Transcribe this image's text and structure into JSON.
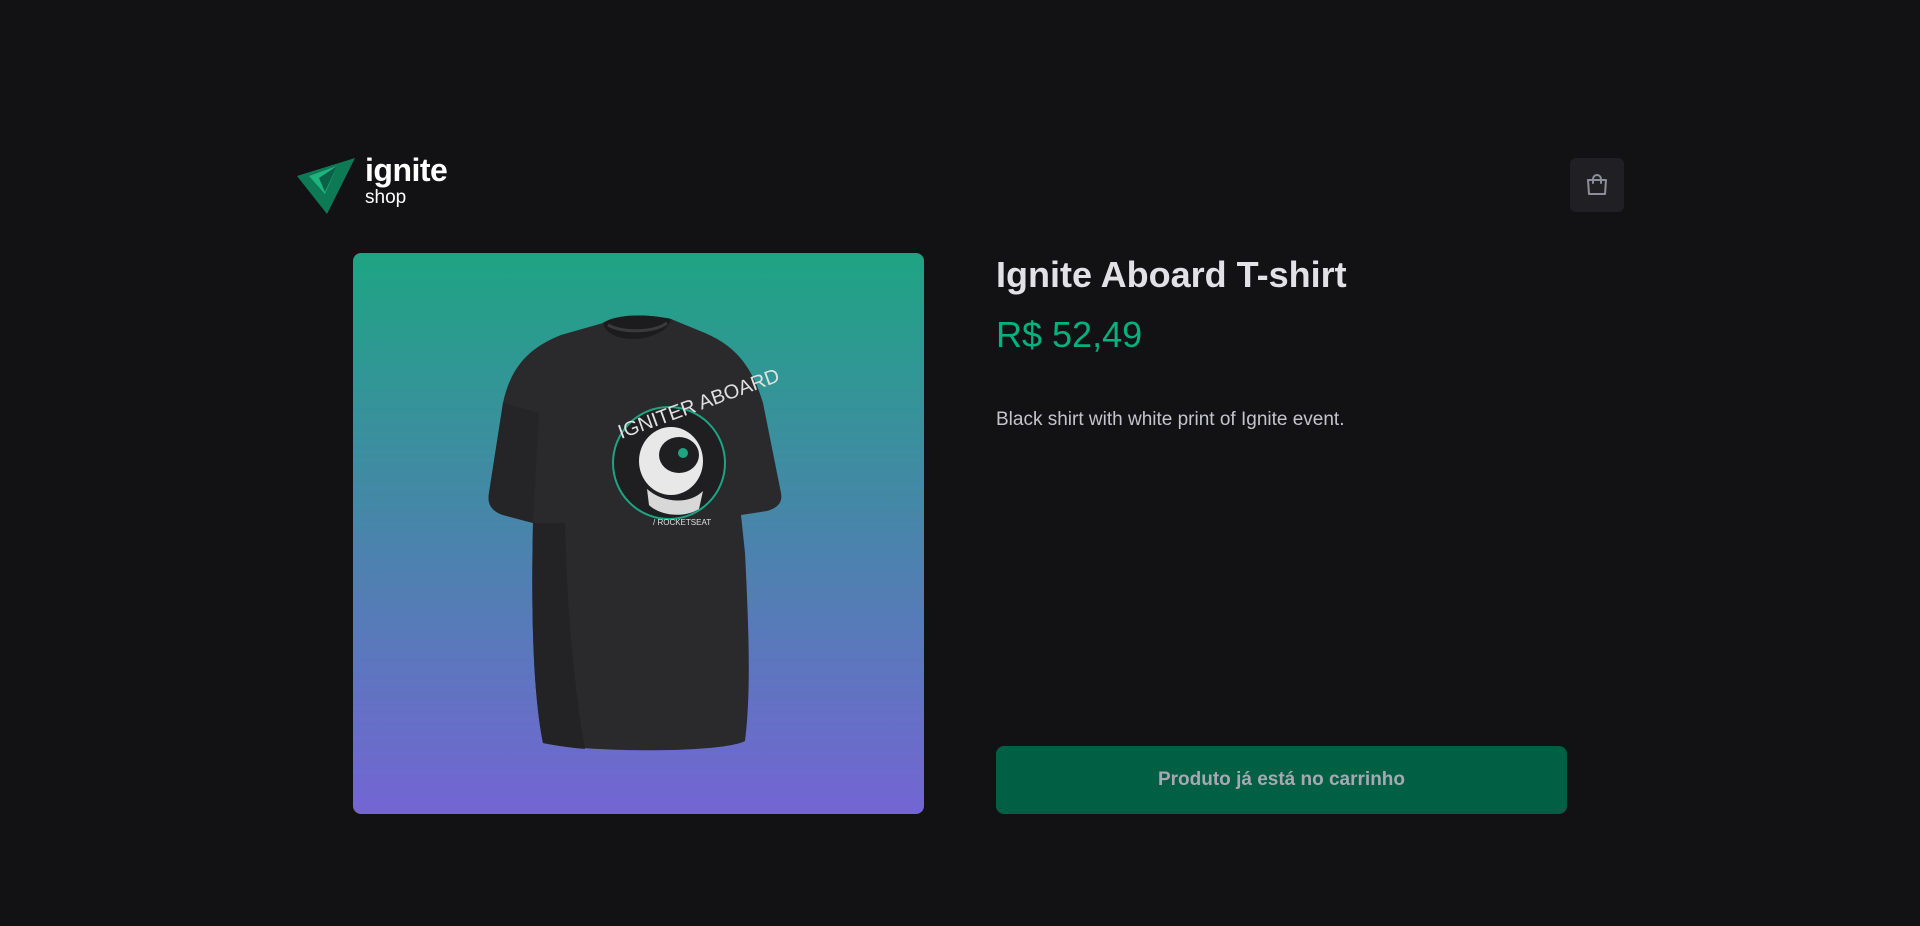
{
  "header": {
    "logo": {
      "title": "ignite",
      "subtitle": "shop"
    },
    "cart_icon": "shopping-bag-icon"
  },
  "product": {
    "image_alt": "Black t-shirt with Igniter Aboard astronaut print",
    "print_text": "IGNITER ABOARD",
    "title": "Ignite Aboard T-shirt",
    "price": "R$ 52,49",
    "description": "Black shirt with white print of Ignite event.",
    "button_label": "Produto já está no carrinho"
  },
  "colors": {
    "background": "#121214",
    "accent": "#00b37e",
    "button_bg": "#015f43",
    "gradient_top": "#1ea483",
    "gradient_bottom": "#7465d4"
  }
}
